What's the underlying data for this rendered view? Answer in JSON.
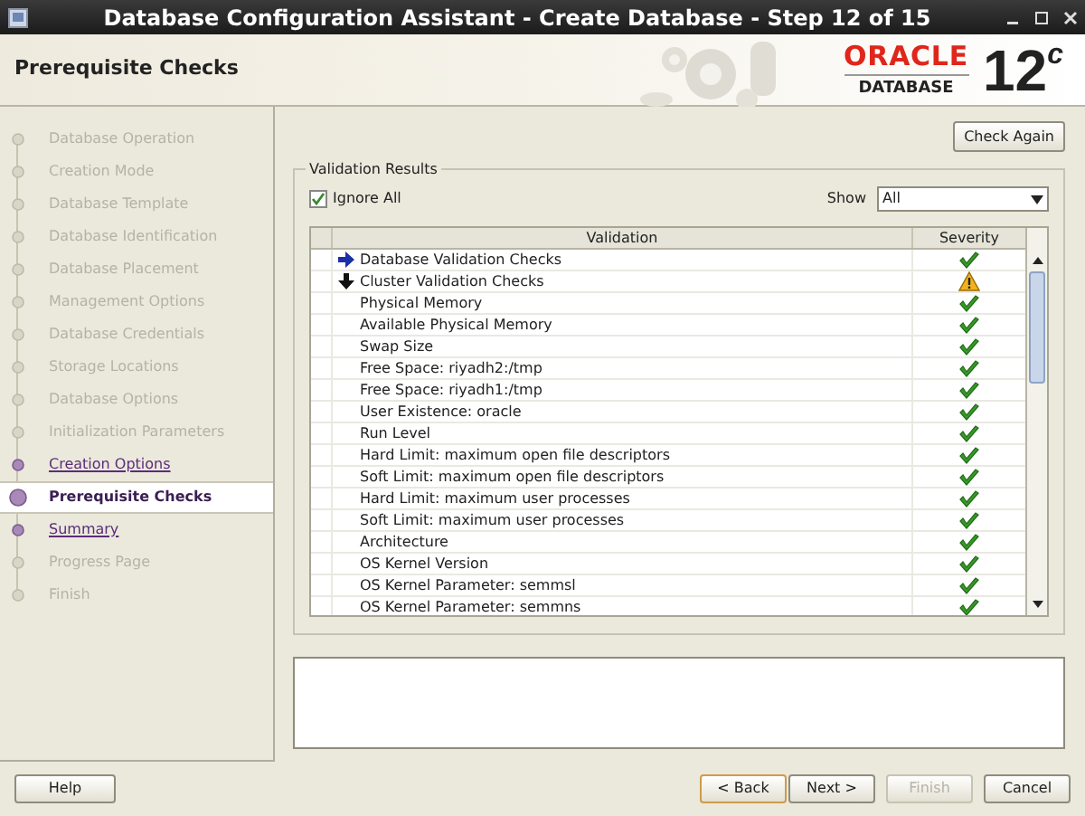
{
  "window": {
    "title": "Database Configuration Assistant - Create Database - Step 12 of 15"
  },
  "header": {
    "title": "Prerequisite Checks",
    "brand": "ORACLE",
    "product": "DATABASE",
    "version": "12",
    "version_suffix": "c"
  },
  "steps": [
    {
      "label": "Database Operation",
      "kind": "disabled"
    },
    {
      "label": "Creation Mode",
      "kind": "disabled"
    },
    {
      "label": "Database Template",
      "kind": "disabled"
    },
    {
      "label": "Database Identification",
      "kind": "disabled"
    },
    {
      "label": "Database Placement",
      "kind": "disabled"
    },
    {
      "label": "Management Options",
      "kind": "disabled"
    },
    {
      "label": "Database Credentials",
      "kind": "disabled"
    },
    {
      "label": "Storage Locations",
      "kind": "disabled"
    },
    {
      "label": "Database Options",
      "kind": "disabled"
    },
    {
      "label": "Initialization Parameters",
      "kind": "disabled"
    },
    {
      "label": "Creation Options",
      "kind": "link"
    },
    {
      "label": "Prerequisite Checks",
      "kind": "current"
    },
    {
      "label": "Summary",
      "kind": "link"
    },
    {
      "label": "Progress Page",
      "kind": "disabled"
    },
    {
      "label": "Finish",
      "kind": "disabled"
    }
  ],
  "check_again": "Check Again",
  "validation_results": {
    "title": "Validation Results",
    "ignore_all": {
      "label": "Ignore All",
      "checked": true
    },
    "show": {
      "label": "Show",
      "value": "All"
    },
    "columns": [
      "Validation",
      "Severity"
    ],
    "rows": [
      {
        "kind": "group",
        "label": "Database Validation Checks",
        "expanded": false,
        "warning": false
      },
      {
        "kind": "group",
        "label": "Cluster Validation Checks",
        "expanded": true,
        "warning": true
      },
      {
        "kind": "item",
        "label": "Physical Memory",
        "warning": false
      },
      {
        "kind": "item",
        "label": "Available Physical Memory",
        "warning": false
      },
      {
        "kind": "item",
        "label": "Swap Size",
        "warning": false
      },
      {
        "kind": "item",
        "label": "Free Space: riyadh2:/tmp",
        "warning": false
      },
      {
        "kind": "item",
        "label": "Free Space: riyadh1:/tmp",
        "warning": false
      },
      {
        "kind": "item",
        "label": "User Existence: oracle",
        "warning": false
      },
      {
        "kind": "item",
        "label": "Run Level",
        "warning": false
      },
      {
        "kind": "item",
        "label": "Hard Limit: maximum open file descriptors",
        "warning": false
      },
      {
        "kind": "item",
        "label": "Soft Limit: maximum open file descriptors",
        "warning": false
      },
      {
        "kind": "item",
        "label": "Hard Limit: maximum user processes",
        "warning": false
      },
      {
        "kind": "item",
        "label": "Soft Limit: maximum user processes",
        "warning": false
      },
      {
        "kind": "item",
        "label": "Architecture",
        "warning": false
      },
      {
        "kind": "item",
        "label": "OS Kernel Version",
        "warning": false
      },
      {
        "kind": "item",
        "label": "OS Kernel Parameter: semmsl",
        "warning": false
      },
      {
        "kind": "item",
        "label": "OS Kernel Parameter: semmns",
        "warning": false
      }
    ]
  },
  "buttons": [
    {
      "label": "Help",
      "disabled": false,
      "default": false
    },
    {
      "label": "< Back",
      "disabled": false,
      "default": true
    },
    {
      "label": "Next >",
      "disabled": false,
      "default": false
    },
    {
      "label": "Finish",
      "disabled": true,
      "default": false
    },
    {
      "label": "Cancel",
      "disabled": false,
      "default": false
    }
  ]
}
